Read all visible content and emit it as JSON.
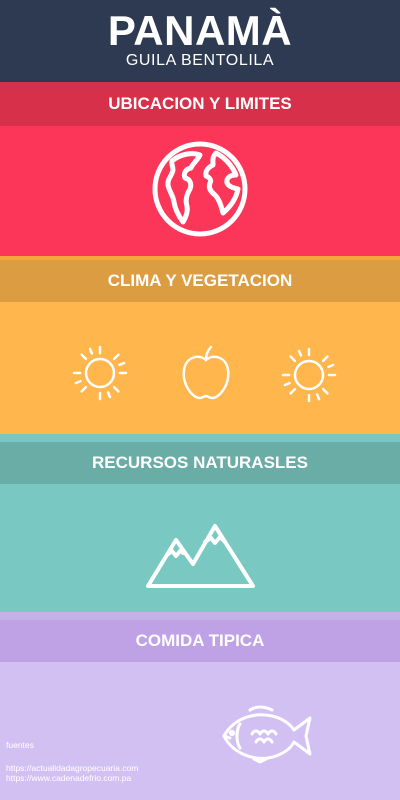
{
  "header": {
    "title": "PANAMÀ",
    "subtitle": "GUILA BENTOLILA"
  },
  "sections": [
    {
      "label": "UBICACION Y LIMITES",
      "icon": "globe-icon"
    },
    {
      "label": "CLIMA Y VEGETACION",
      "icons": [
        "sun-icon",
        "apple-icon",
        "sun-icon"
      ]
    },
    {
      "label": "RECURSOS NATURASLES",
      "icon": "mountains-icon"
    },
    {
      "label": "COMIDA TIPICA",
      "icon": "fish-icon"
    }
  ],
  "footer": {
    "label": "fuentes",
    "links": [
      "https://actualidadagropecuaria.com",
      "https://www.cadenadefrio.com.pa"
    ]
  },
  "colors": {
    "header": "#2d3a51",
    "section1": "#fb3658",
    "section2": "#ffb64c",
    "section3": "#79c9c2",
    "section4": "#d3c0f3",
    "icon": "#ffffff"
  }
}
